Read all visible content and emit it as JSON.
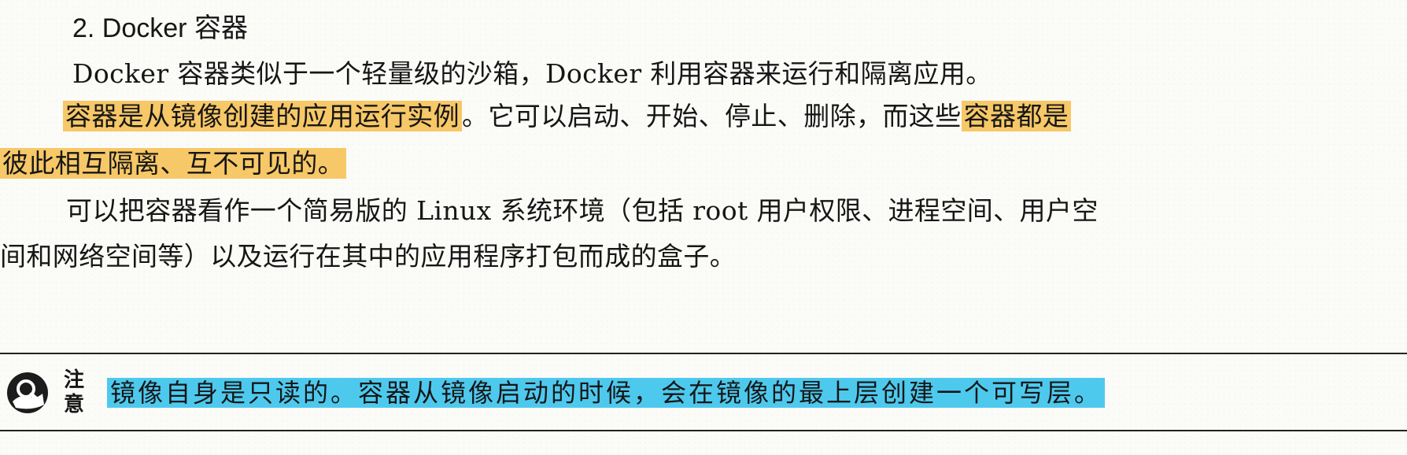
{
  "section": {
    "heading": "2. Docker 容器"
  },
  "paragraph1": {
    "text": "Docker 容器类似于一个轻量级的沙箱，Docker 利用容器来运行和隔离应用。"
  },
  "paragraph2": {
    "highlight1": "容器是从镜像创建的应用运行实例",
    "middle": "。它可以启动、开始、停止、删除，而这些",
    "highlight2_line1": "容器都是",
    "highlight2_line2": "彼此相互隔离、互不可见的。"
  },
  "paragraph3": {
    "line1": "可以把容器看作一个简易版的 Linux 系统环境（包括 root 用户权限、进程空间、用户空",
    "line2": "间和网络空间等）以及运行在其中的应用程序打包而成的盒子。"
  },
  "note": {
    "label_top": "注",
    "label_bottom": "意",
    "text": "镜像自身是只读的。容器从镜像启动的时候，会在镜像的最上层创建一个可写层。"
  },
  "colors": {
    "highlight_yellow": "#f7c867",
    "highlight_cyan": "#4ec9ee"
  },
  "icons": {
    "note_icon": "magnifier-note-icon"
  }
}
